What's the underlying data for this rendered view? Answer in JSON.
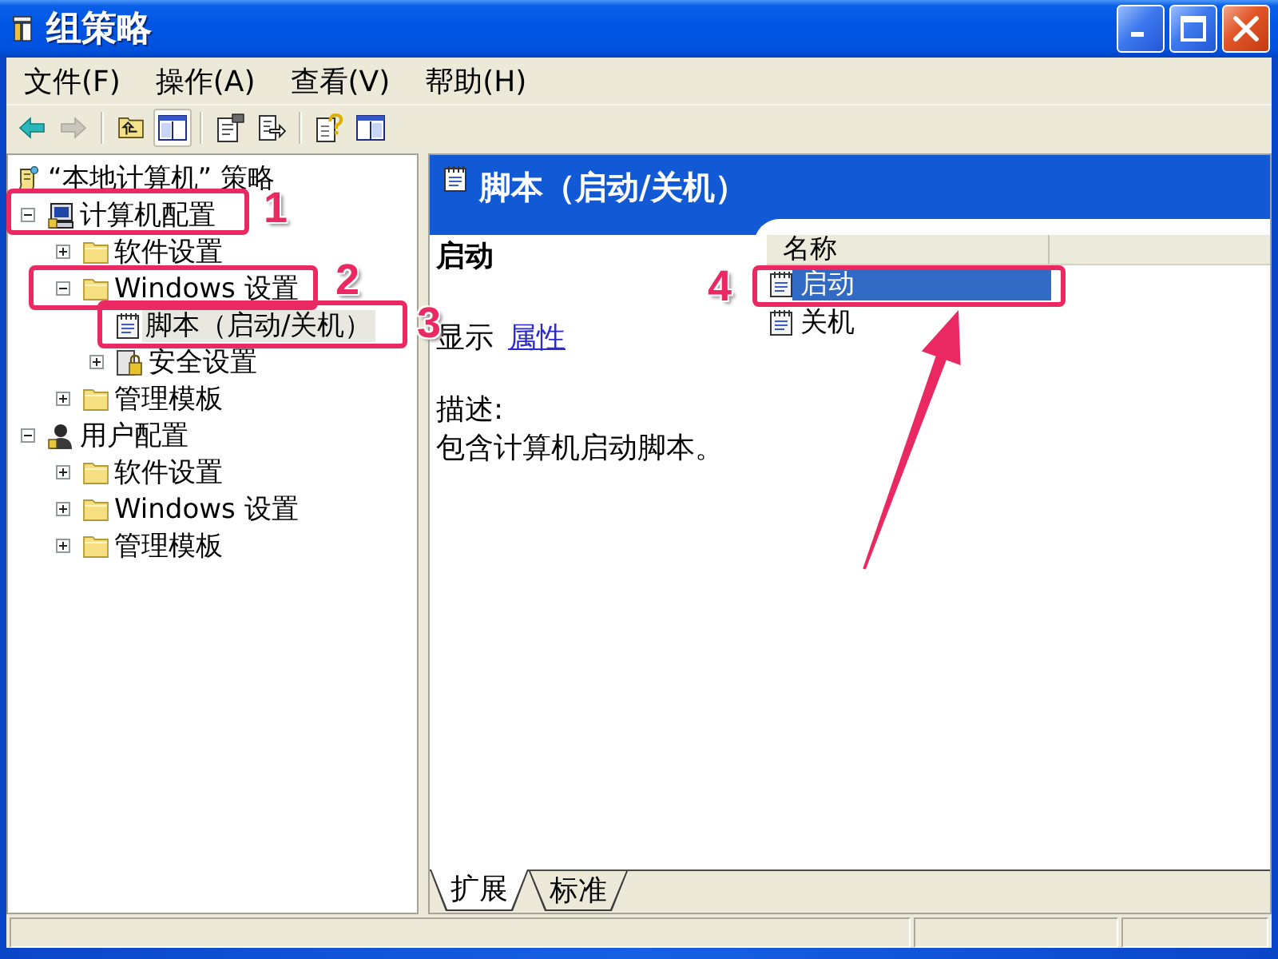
{
  "window": {
    "title": "组策略"
  },
  "menu": [
    "文件(F)",
    "操作(A)",
    "查看(V)",
    "帮助(H)"
  ],
  "toolbar": {
    "back": {
      "disabled": false
    },
    "forward": {
      "disabled": true
    },
    "show_tree": {
      "pressed": true
    }
  },
  "tree": {
    "label": "“本地计算机” 策略",
    "kind": "policy",
    "selected": false,
    "children": [
      {
        "label": "计算机配置",
        "kind": "computer",
        "expanded": true,
        "selected": false,
        "children": [
          {
            "label": "软件设置",
            "kind": "folder",
            "expanded": false,
            "selected": false
          },
          {
            "label": "Windows 设置",
            "kind": "folder",
            "expanded": true,
            "selected": false,
            "children": [
              {
                "label": "脚本（启动/关机）",
                "kind": "script",
                "selected": true
              },
              {
                "label": "安全设置",
                "kind": "security",
                "expanded": false,
                "selected": false
              }
            ]
          },
          {
            "label": "管理模板",
            "kind": "folder",
            "expanded": false,
            "selected": false
          }
        ]
      },
      {
        "label": "用户配置",
        "kind": "user",
        "expanded": true,
        "selected": false,
        "children": [
          {
            "label": "软件设置",
            "kind": "folder",
            "expanded": false,
            "selected": false
          },
          {
            "label": "Windows 设置",
            "kind": "folder",
            "expanded": false,
            "selected": false
          },
          {
            "label": "管理模板",
            "kind": "folder",
            "expanded": false,
            "selected": false
          }
        ]
      }
    ]
  },
  "details": {
    "title": "脚本（启动/关机）",
    "item_title": "启动",
    "show_label": "显示",
    "show_link": "属性",
    "description_label": "描述:",
    "description": "包含计算机启动脚本。",
    "list": {
      "columns": [
        "名称"
      ],
      "rows": [
        {
          "name": "启动",
          "selected": true
        },
        {
          "name": "关机",
          "selected": false
        }
      ]
    }
  },
  "view_tabs": [
    {
      "label": "扩展",
      "selected": true
    },
    {
      "label": "标准",
      "selected": false
    }
  ],
  "annotations": [
    {
      "number": "1"
    },
    {
      "number": "2"
    },
    {
      "number": "3"
    },
    {
      "number": "4"
    }
  ]
}
